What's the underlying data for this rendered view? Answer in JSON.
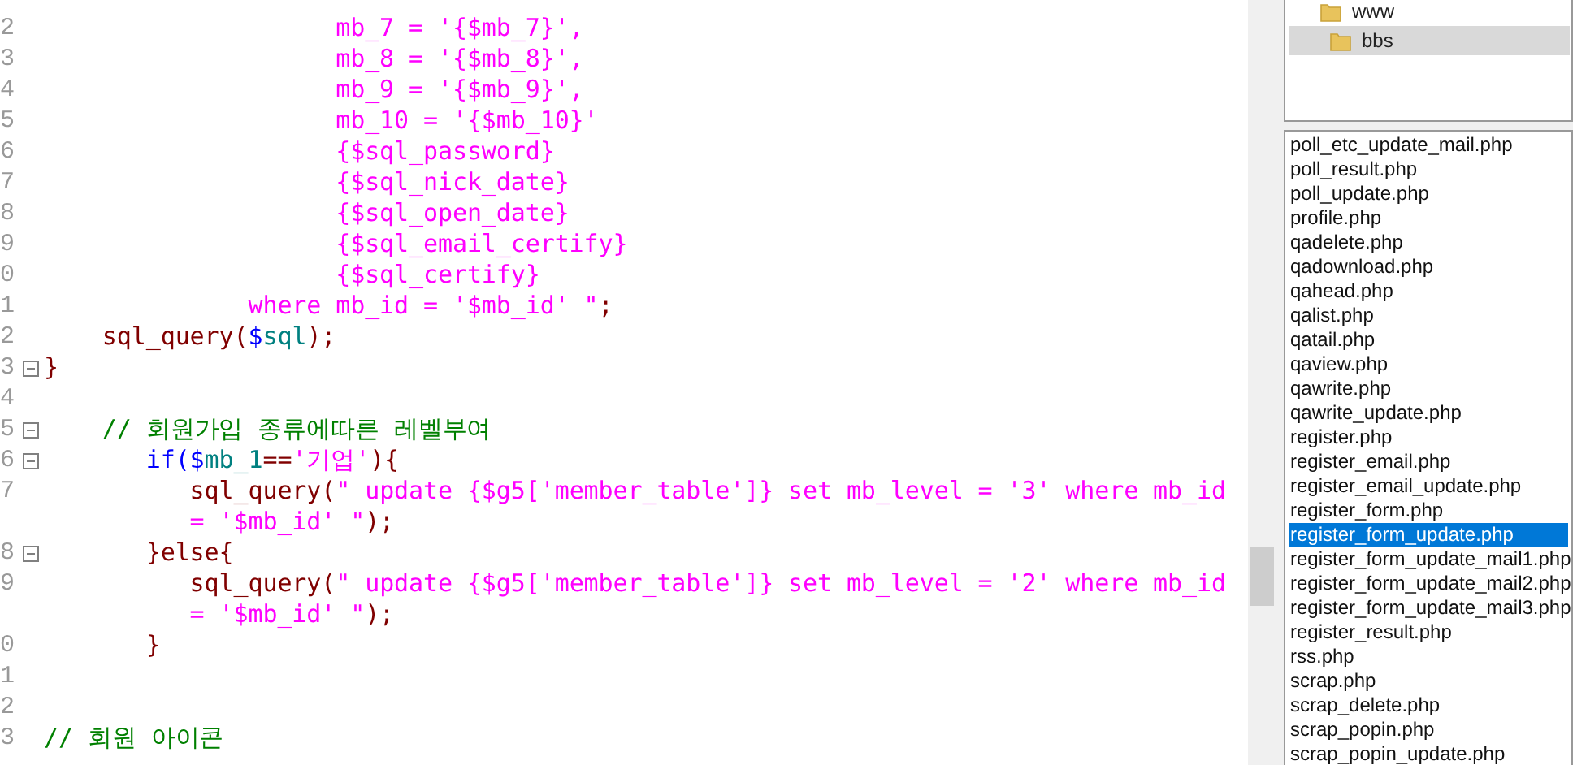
{
  "editor": {
    "lines": [
      {
        "number": "2",
        "foldable": false,
        "segments": [
          {
            "kind": "string",
            "text": "                    mb_7 = '{$mb_7}',"
          }
        ]
      },
      {
        "number": "3",
        "foldable": false,
        "segments": [
          {
            "kind": "string",
            "text": "                    mb_8 = '{$mb_8}',"
          }
        ]
      },
      {
        "number": "4",
        "foldable": false,
        "segments": [
          {
            "kind": "string",
            "text": "                    mb_9 = '{$mb_9}',"
          }
        ]
      },
      {
        "number": "5",
        "foldable": false,
        "segments": [
          {
            "kind": "string",
            "text": "                    mb_10 = '{$mb_10}'"
          }
        ]
      },
      {
        "number": "6",
        "foldable": false,
        "segments": [
          {
            "kind": "string",
            "text": "                    {$sql_password}"
          }
        ]
      },
      {
        "number": "7",
        "foldable": false,
        "segments": [
          {
            "kind": "string",
            "text": "                    {$sql_nick_date}"
          }
        ]
      },
      {
        "number": "8",
        "foldable": false,
        "segments": [
          {
            "kind": "string",
            "text": "                    {$sql_open_date}"
          }
        ]
      },
      {
        "number": "9",
        "foldable": false,
        "segments": [
          {
            "kind": "string",
            "text": "                    {$sql_email_certify}"
          }
        ]
      },
      {
        "number": "0",
        "foldable": false,
        "segments": [
          {
            "kind": "string",
            "text": "                    {$sql_certify}"
          }
        ]
      },
      {
        "number": "1",
        "foldable": false,
        "segments": [
          {
            "kind": "string",
            "text": "              where mb_id = '$mb_id' \""
          },
          {
            "kind": "punct",
            "text": ";"
          }
        ]
      },
      {
        "number": "2",
        "foldable": false,
        "segments": [
          {
            "kind": "func",
            "text": "    sql_query"
          },
          {
            "kind": "punct",
            "text": "("
          },
          {
            "kind": "keyword",
            "text": "$"
          },
          {
            "kind": "variable",
            "text": "sql"
          },
          {
            "kind": "punct",
            "text": ");"
          }
        ]
      },
      {
        "number": "3",
        "foldable": true,
        "segments": [
          {
            "kind": "punct",
            "text": "}"
          }
        ]
      },
      {
        "number": "4",
        "foldable": false
      },
      {
        "number": "5",
        "foldable": true,
        "segments": [
          {
            "kind": "comment",
            "text": "    // 회원가입 종류에따른 레벨부여"
          }
        ]
      },
      {
        "number": "6",
        "foldable": true,
        "segments": [
          {
            "kind": "keyword",
            "text": "       if($"
          },
          {
            "kind": "variable",
            "text": "mb_1"
          },
          {
            "kind": "punct",
            "text": "=="
          },
          {
            "kind": "string",
            "text": "'기업'"
          },
          {
            "kind": "punct",
            "text": "){"
          }
        ]
      },
      {
        "number": "7",
        "foldable": false,
        "segments": [
          {
            "kind": "func",
            "text": "          sql_query("
          },
          {
            "kind": "string",
            "text": "\" update {$g5['member_table']} set mb_level = '3' where mb_id"
          }
        ]
      },
      {
        "foldable": false,
        "segments": [
          {
            "kind": "string",
            "text": "          = '$mb_id' \""
          },
          {
            "kind": "punct",
            "text": ");"
          }
        ]
      },
      {
        "number": "8",
        "foldable": true,
        "segments": [
          {
            "kind": "punct",
            "text": "       }else{"
          }
        ]
      },
      {
        "number": "9",
        "foldable": false,
        "segments": [
          {
            "kind": "func",
            "text": "          sql_query("
          },
          {
            "kind": "string",
            "text": "\" update {$g5['member_table']} set mb_level = '2' where mb_id"
          }
        ]
      },
      {
        "foldable": false,
        "segments": [
          {
            "kind": "string",
            "text": "          = '$mb_id' \""
          },
          {
            "kind": "punct",
            "text": ");"
          }
        ]
      },
      {
        "number": "0",
        "foldable": false,
        "segments": [
          {
            "kind": "punct",
            "text": "       }"
          }
        ]
      },
      {
        "number": "1",
        "foldable": false
      },
      {
        "number": "2",
        "foldable": false
      },
      {
        "number": "3",
        "foldable": false,
        "segments": [
          {
            "kind": "comment",
            "text": "// 회원 아이콘"
          }
        ]
      }
    ]
  },
  "folder_tree": [
    {
      "label": "www",
      "selected": false,
      "children": [
        {
          "label": "bbs",
          "selected": true
        }
      ]
    }
  ],
  "files": [
    {
      "label": "poll_etc_update_mail.php",
      "selected": false
    },
    {
      "label": "poll_result.php",
      "selected": false
    },
    {
      "label": "poll_update.php",
      "selected": false
    },
    {
      "label": "profile.php",
      "selected": false
    },
    {
      "label": "qadelete.php",
      "selected": false
    },
    {
      "label": "qadownload.php",
      "selected": false
    },
    {
      "label": "qahead.php",
      "selected": false
    },
    {
      "label": "qalist.php",
      "selected": false
    },
    {
      "label": "qatail.php",
      "selected": false
    },
    {
      "label": "qaview.php",
      "selected": false
    },
    {
      "label": "qawrite.php",
      "selected": false
    },
    {
      "label": "qawrite_update.php",
      "selected": false
    },
    {
      "label": "register.php",
      "selected": false
    },
    {
      "label": "register_email.php",
      "selected": false
    },
    {
      "label": "register_email_update.php",
      "selected": false
    },
    {
      "label": "register_form.php",
      "selected": false
    },
    {
      "label": "register_form_update.php",
      "selected": true
    },
    {
      "label": "register_form_update_mail1.php",
      "selected": false
    },
    {
      "label": "register_form_update_mail2.php",
      "selected": false
    },
    {
      "label": "register_form_update_mail3.php",
      "selected": false
    },
    {
      "label": "register_result.php",
      "selected": false
    },
    {
      "label": "rss.php",
      "selected": false
    },
    {
      "label": "scrap.php",
      "selected": false
    },
    {
      "label": "scrap_delete.php",
      "selected": false
    },
    {
      "label": "scrap_popin.php",
      "selected": false
    },
    {
      "label": "scrap_popin_update.php",
      "selected": false
    }
  ]
}
